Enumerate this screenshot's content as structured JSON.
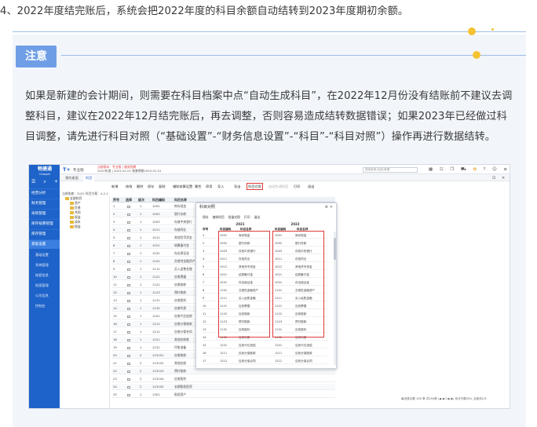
{
  "intro_line": "4、2022年度结完账后，系统会把2022年度的科目余额自动结转到2023年度期初余额。",
  "note": {
    "label": "注意",
    "paragraph": "如果是新建的会计期间，则需要在科目档案中点“自动生成科目”，在2022年12月份没有结账前不建议去调整科目，建议在2022年12月结完账后，再去调整，否则容易造成结转数据错误；如果2023年已经做过科目调整，请先进行科目对照（“基础设置”-“财务信息设置”-“科目”-“科目对照”）操作再进行数据结转。"
  },
  "colors": {
    "badge": "#6f9ee6",
    "sidebar": "#1e63c9",
    "highlight": "#e03a3a",
    "dot": "#f5c233"
  },
  "app": {
    "logo_line1": "畅捷通",
    "logo_line2": "Chanjet",
    "brand": "T+",
    "brand_sub": "专业版",
    "red_notice": "当前版本：专业版 | 服务到期",
    "info": "2022年度 | 2022-01-01  账套期限2025-01-01",
    "search_placeholder": "搜索菜单/功能/单据",
    "header_icons": [
      "grid-icon",
      "list-icon",
      "copy-icon",
      "cart-icon",
      "gift-icon",
      "help-icon",
      "user-icon",
      "menu-icon"
    ],
    "sidebar_top_icons": [
      "menu-icon",
      "search-icon",
      "plus-icon"
    ],
    "sidebar": [
      {
        "label": "经营分析",
        "icon": "chart-icon"
      },
      {
        "label": "财务管理",
        "icon": "money-icon"
      },
      {
        "label": "采购管理",
        "icon": "cart-icon"
      },
      {
        "label": "库存核算管理",
        "icon": "box-icon"
      },
      {
        "label": "库存管理",
        "icon": "warehouse-icon"
      },
      {
        "label": "基础设置",
        "icon": "gear-icon",
        "active": true
      }
    ],
    "sidebar_sub": [
      "基础设置",
      "系统管理",
      "账套信息",
      "档案管理",
      "公司信息",
      "控制台"
    ],
    "tabs": [
      "我的桌面",
      "科目"
    ],
    "toolbar": [
      "新增",
      "修改",
      "删除",
      "保存",
      "复制",
      "辅助核算设置",
      "属性",
      "停用",
      "导入",
      "导出",
      "科目对照",
      "自动生成科目",
      "打印",
      "退出"
    ],
    "tree_filter": "当前账套：2022  科目方案：4-2-2",
    "tree": [
      "全部科目",
      "资产",
      "负债",
      "共同",
      "权益",
      "成本",
      "损益"
    ],
    "grid_headers": [
      "序号",
      "",
      "选择",
      "级次",
      "科目编码",
      "科目名称"
    ],
    "rows": [
      {
        "n": "1",
        "lvl": "1",
        "code": "1001",
        "name": "库存现金"
      },
      {
        "n": "2",
        "lvl": "1",
        "code": "1002",
        "name": "银行存款"
      },
      {
        "n": "3",
        "lvl": "1",
        "code": "1003",
        "name": "存放中央银行"
      },
      {
        "n": "4",
        "lvl": "1",
        "code": "1011",
        "name": "存放同业"
      },
      {
        "n": "5",
        "lvl": "1",
        "code": "1012",
        "name": "其他货币资金"
      },
      {
        "n": "6",
        "lvl": "1",
        "code": "1021",
        "name": "结算备付金"
      },
      {
        "n": "7",
        "lvl": "1",
        "code": "1031",
        "name": "存出保证金"
      },
      {
        "n": "8",
        "lvl": "1",
        "code": "1101",
        "name": "交易性金融资产"
      },
      {
        "n": "9",
        "lvl": "1",
        "code": "1111",
        "name": "买入返售金融"
      },
      {
        "n": "10",
        "lvl": "1",
        "code": "1121",
        "name": "应收票据"
      },
      {
        "n": "11",
        "lvl": "1",
        "code": "1122",
        "name": "应收账款"
      },
      {
        "n": "12",
        "lvl": "1",
        "code": "1123",
        "name": "预付账款"
      },
      {
        "n": "13",
        "lvl": "1",
        "code": "1131",
        "name": "应收股利"
      },
      {
        "n": "14",
        "lvl": "1",
        "code": "1132",
        "name": "应收利息"
      },
      {
        "n": "15",
        "lvl": "1",
        "code": "1201",
        "name": "应收代位追偿"
      },
      {
        "n": "16",
        "lvl": "1",
        "code": "1211",
        "name": "应收分保账款"
      },
      {
        "n": "17",
        "lvl": "1",
        "code": "1212",
        "name": "应收分保合同"
      },
      {
        "n": "18",
        "lvl": "1",
        "code": "1221",
        "name": "其他应收款"
      },
      {
        "n": "19",
        "lvl": "1",
        "code": "1231",
        "name": "坏账准备"
      },
      {
        "n": "20",
        "lvl": "2",
        "code": "123101",
        "name": "应收账款"
      },
      {
        "n": "21",
        "lvl": "2",
        "code": "123102",
        "name": "其他应收"
      },
      {
        "n": "22",
        "lvl": "2",
        "code": "123103",
        "name": "预付账款"
      },
      {
        "n": "23",
        "lvl": "2",
        "code": "123104",
        "name": "应收股利"
      },
      {
        "n": "24",
        "lvl": "2",
        "code": "123105",
        "name": "长期股权投资"
      },
      {
        "n": "25",
        "lvl": "1",
        "code": "1301",
        "name": "贴现资产"
      }
    ],
    "pager": "每页显示数 100  条  共254条  |◀  ◀  1  ▶  ▶|  总计行数254, 当前页1/3"
  },
  "dialog": {
    "title": "科目对照",
    "toolbar": [
      "保存",
      "复制科目",
      "批量对照",
      "打印",
      "退出"
    ],
    "year_left": "2021",
    "year_right": "2022",
    "headers": [
      "序号",
      "科目编码",
      "科目名称",
      "科目编码",
      "科目名称"
    ],
    "rows": [
      {
        "n": "1",
        "c1": "1001",
        "m1": "库存现金",
        "c2": "1001",
        "m2": "库存现金"
      },
      {
        "n": "2",
        "c1": "1002",
        "m1": "银行存款",
        "c2": "1002",
        "m2": "银行存款"
      },
      {
        "n": "3",
        "c1": "1003",
        "m1": "存放中央银行",
        "c2": "1003",
        "m2": "存放中央银行"
      },
      {
        "n": "4",
        "c1": "1011",
        "m1": "存放同业",
        "c2": "1011",
        "m2": "存放同业"
      },
      {
        "n": "5",
        "c1": "1012",
        "m1": "其他货币资金",
        "c2": "1012",
        "m2": "其他货币资金"
      },
      {
        "n": "6",
        "c1": "1021",
        "m1": "结算备付金",
        "c2": "1021",
        "m2": "结算备付金"
      },
      {
        "n": "7",
        "c1": "1031",
        "m1": "存出保证金",
        "c2": "1031",
        "m2": "存出保证金"
      },
      {
        "n": "8",
        "c1": "1101",
        "m1": "交易性金融资产",
        "c2": "1101",
        "m2": "交易性金融资产"
      },
      {
        "n": "9",
        "c1": "1111",
        "m1": "买入返售金融",
        "c2": "1111",
        "m2": "买入返售金融"
      },
      {
        "n": "10",
        "c1": "1121",
        "m1": "应收票据",
        "c2": "1121",
        "m2": "应收票据"
      },
      {
        "n": "11",
        "c1": "1122",
        "m1": "应收账款",
        "c2": "1122",
        "m2": "应收账款"
      },
      {
        "n": "12",
        "c1": "1123",
        "m1": "预付账款",
        "c2": "1123",
        "m2": "预付账款"
      },
      {
        "n": "13",
        "c1": "1131",
        "m1": "应收股利",
        "c2": "1131",
        "m2": "应收股利"
      },
      {
        "n": "14",
        "c1": "1132",
        "m1": "应收利息",
        "c2": "1132",
        "m2": "应收利息"
      },
      {
        "n": "15",
        "c1": "1201",
        "m1": "应收代位追偿",
        "c2": "1201",
        "m2": "应收代位追偿"
      },
      {
        "n": "16",
        "c1": "1211",
        "m1": "应收分保账款",
        "c2": "1211",
        "m2": "应收分保账款"
      },
      {
        "n": "17",
        "c1": "1212",
        "m1": "应收分保合同",
        "c2": "1212",
        "m2": "应收分保合同"
      }
    ]
  }
}
